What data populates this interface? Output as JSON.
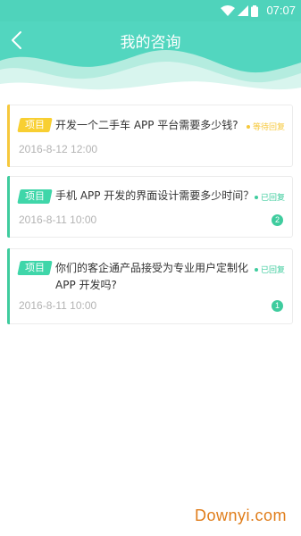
{
  "status_bar": {
    "time": "07:07"
  },
  "header": {
    "title": "我的咨询",
    "back_icon": "chevron-left-icon"
  },
  "colors": {
    "header": "#52d6bf",
    "pending": "#f6c83c",
    "replied": "#3fcc9e",
    "tag_pending": "#f8cf32",
    "tag_replied": "#3fd6a9"
  },
  "consultations": [
    {
      "tag": "项目",
      "question": "开发一个二手车 APP 平台需要多少钱?",
      "status": "等待回复",
      "date": "2016-8-12 12:00",
      "badge": null
    },
    {
      "tag": "项目",
      "question": "手机 APP 开发的界面设计需要多少时间？",
      "status": "已回复",
      "date": "2016-8-11 10:00",
      "badge": "2"
    },
    {
      "tag": "项目",
      "question_line1": "你们的客企通产品接受为专业用户定制化",
      "question_line2": "APP 开发吗?",
      "status": "已回复",
      "date": "2016-8-11 10:00",
      "badge": "1"
    }
  ],
  "watermark": "Downyi.com"
}
